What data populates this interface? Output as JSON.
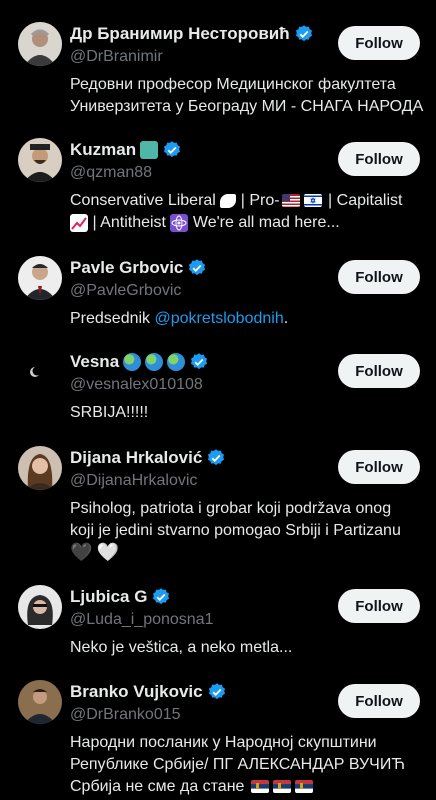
{
  "follow_label": "Follow",
  "colors": {
    "background": "#000000",
    "text": "#e7e9ea",
    "secondary": "#71767b",
    "verified": "#1d9bf0",
    "mention": "#1d9bf0",
    "button_bg": "#eff3f4"
  },
  "users": [
    {
      "name": "Др Бранимир Несторовић",
      "handle": "@DrBranimir",
      "verified": true,
      "bio_lines": [
        "Редовни професор Медицинског факултета",
        "Универзитета у Београду МИ - СНАГА НАРОДА"
      ]
    },
    {
      "name": "Kuzman",
      "name_emoji": "statue-of-liberty-emoji",
      "handle": "@qzman88",
      "verified": true,
      "bio_line1_a": "Conservative Liberal",
      "bio_line1_b": "| Pro-",
      "bio_line1_c": "| Capitalist",
      "bio_line2_b": "| Antitheist",
      "bio_line2_d": "We're all mad here...",
      "bio_icons": [
        "eagle-emoji",
        "us-flag-emoji",
        "israel-flag-emoji",
        "chart-up-emoji",
        "atom-emoji"
      ]
    },
    {
      "name": "Pavle Grbovic",
      "handle": "@PavleGrbovic",
      "verified": true,
      "bio_prefix": "Predsednik ",
      "bio_mention": "@pokretslobodnih",
      "bio_suffix": "."
    },
    {
      "name": "Vesna",
      "name_emoji": "globe-emoji x3",
      "handle": "@vesnalex010108",
      "verified": true,
      "bio_lines": [
        "SRBIJA!!!!!"
      ]
    },
    {
      "name": "Dijana Hrkalović",
      "handle": "@DijanaHrkalovic",
      "verified": true,
      "bio_lines": [
        "Psiholog, patriota i grobar koji podržava onog",
        "koji je jedini stvarno pomogao Srbiji i Partizanu"
      ],
      "bio_emoji": [
        "🖤",
        "🤍"
      ]
    },
    {
      "name": "Ljubica G",
      "handle": "@Luda_i_ponosna1",
      "verified": true,
      "bio_lines": [
        "Neko je veštica, a neko metla..."
      ]
    },
    {
      "name": "Branko Vujkovic",
      "handle": "@DrBranko015",
      "verified": true,
      "bio_lines": [
        "Народни посланик у Народној скупштини",
        "Републике Србије/ ПГ АЛЕКСАНДАР ВУЧИЋ",
        "Србија не сме да стане"
      ],
      "bio_icons": [
        "serbia-flag-emoji x3"
      ]
    }
  ]
}
